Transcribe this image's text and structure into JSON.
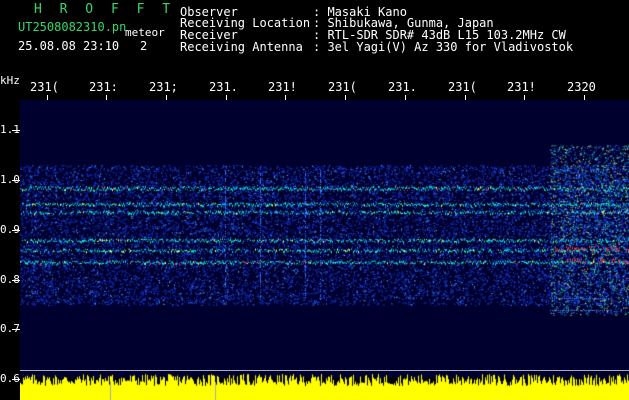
{
  "header": {
    "app_title": "H R O F F T",
    "filename": "UT2508082310.pn",
    "meteor_label": "meteor",
    "datetime": "25.08.08 23:10",
    "count": "2",
    "fields": [
      {
        "label": "Observer",
        "value": ": Masaki Kano"
      },
      {
        "label": "Receiving Location",
        "value": ": Shibukawa, Gunma, Japan"
      },
      {
        "label": "Receiver",
        "value": ": RTL-SDR SDR# 43dB L15 103.2MHz CW"
      },
      {
        "label": "Receiving Antenna",
        "value": ": 3el Yagi(V) Az 330 for Vladivostok"
      }
    ]
  },
  "axes": {
    "y_unit": "kHz",
    "y_ticks": [
      "1.1",
      "1.0",
      "0.9",
      "0.8",
      "0.7",
      "0.6"
    ],
    "x_ticks": [
      "231(",
      "231:",
      "231;",
      "231.",
      "231!",
      "231(",
      "231.",
      "231(",
      "231!",
      "2320"
    ]
  },
  "colors": {
    "background": "#00002e",
    "signal_low": "#1a3cff",
    "signal_mid": "#00ffc0",
    "signal_high": "#ff3030",
    "amplitude": "#ffff00",
    "header_text": "#35d66a"
  }
}
